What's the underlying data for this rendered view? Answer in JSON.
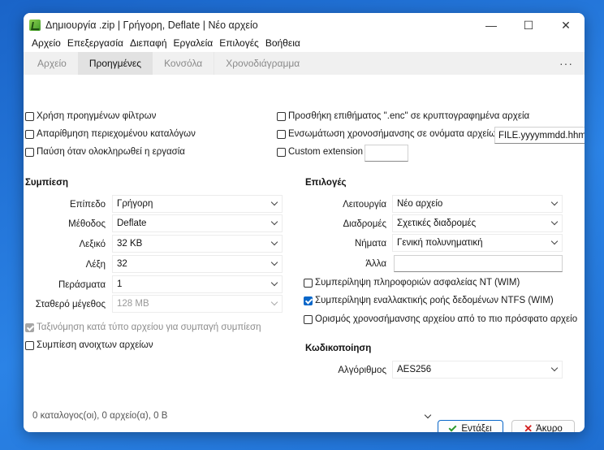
{
  "window": {
    "title": "Δημιουργία .zip | Γρήγορη, Deflate | Νέο αρχείο",
    "controls": {
      "minimize": "—",
      "maximize": "☐",
      "close": "✕"
    }
  },
  "menu": [
    "Αρχείο",
    "Επεξεργασία",
    "Διεπαφή",
    "Εργαλεία",
    "Επιλογές",
    "Βοήθεια"
  ],
  "tabs": [
    {
      "label": "Αρχείο",
      "active": false
    },
    {
      "label": "Προηγμένες",
      "active": true
    },
    {
      "label": "Κονσόλα",
      "active": false
    },
    {
      "label": "Χρονοδιάγραμμα",
      "active": false
    }
  ],
  "tabs_more": "···",
  "top_left_checks": [
    {
      "label": "Χρήση προηγμένων φίλτρων",
      "checked": false
    },
    {
      "label": "Απαρίθμηση περιεχομένου καταλόγων",
      "checked": false
    },
    {
      "label": "Παύση όταν ολοκληρωθεί η εργασία",
      "checked": false
    }
  ],
  "top_right_checks": [
    {
      "label": "Προσθήκη επιθήματος \".enc\" σε κρυπτογραφημένα αρχεία",
      "checked": false
    },
    {
      "label": "Ενσωμάτωση χρονοσήμανσης σε ονόματα αρχείων",
      "checked": false,
      "field_value": "FILE.yyyymmdd.hhmmss"
    },
    {
      "label": "Custom extension",
      "checked": false,
      "field_value": ""
    }
  ],
  "compression": {
    "title": "Συμπίεση",
    "level_label": "Επίπεδο",
    "level_value": "Γρήγορη",
    "method_label": "Μέθοδος",
    "method_value": "Deflate",
    "dict_label": "Λεξικό",
    "dict_value": "32 KB",
    "word_label": "Λέξη",
    "word_value": "32",
    "passes_label": "Περάσματα",
    "passes_value": "1",
    "solid_label": "Σταθερό μέγεθος",
    "solid_value": "128 MB",
    "sort_check": {
      "label": "Ταξινόμηση κατά τύπο αρχείου για συμπαγή συμπίεση",
      "checked": true,
      "disabled": true
    },
    "open_check": {
      "label": "Συμπίεση ανοιχτων αρχείων",
      "checked": false
    }
  },
  "options": {
    "title": "Επιλογές",
    "mode_label": "Λειτουργία",
    "mode_value": "Νέο αρχείο",
    "paths_label": "Διαδρομές",
    "paths_value": "Σχετικές διαδρομές",
    "threads_label": "Νήματα",
    "threads_value": "Γενική πολυνηματική",
    "other_label": "Άλλα",
    "other_value": "",
    "checks": [
      {
        "label": "Συμπερίληψη πληροφοριών ασφαλείας NT (WIM)",
        "checked": false
      },
      {
        "label": "Συμπερίληψη εναλλακτικής ροής δεδομένων NTFS (WIM)",
        "checked": true
      },
      {
        "label": "Ορισμός χρονοσήμανσης αρχείου από το πιο πρόσφατο αρχείο",
        "checked": false
      }
    ]
  },
  "encryption": {
    "title": "Κωδικοποίηση",
    "algo_label": "Αλγόριθμος",
    "algo_value": "AES256"
  },
  "footer": {
    "status": "0 καταλογος(οι), 0 αρχείο(α), 0 B",
    "ok_label": "Εντάξει",
    "cancel_label": "Άκυρο"
  },
  "colors": {
    "accent": "#0a67c9",
    "desktop": "#1f72d6"
  }
}
